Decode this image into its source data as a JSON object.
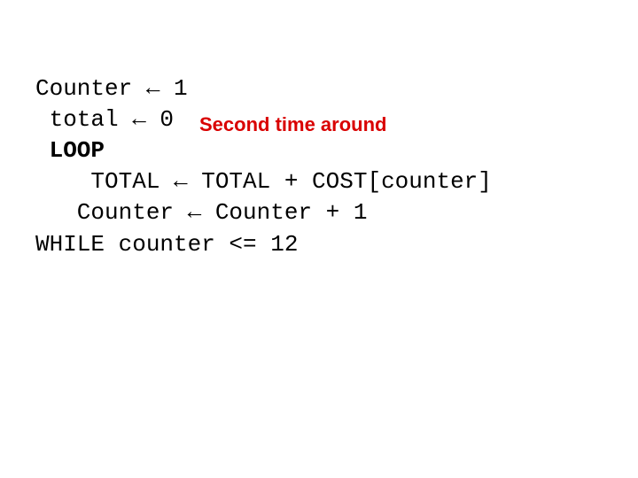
{
  "lines": {
    "l1": "Counter ← 1",
    "l2": " total ← 0",
    "l3": " LOOP",
    "l4": "    TOTAL ← TOTAL + COST[counter]",
    "l5": "   Counter ← Counter + 1",
    "l6": "WHILE counter <= 12"
  },
  "annotation": "Second time around"
}
